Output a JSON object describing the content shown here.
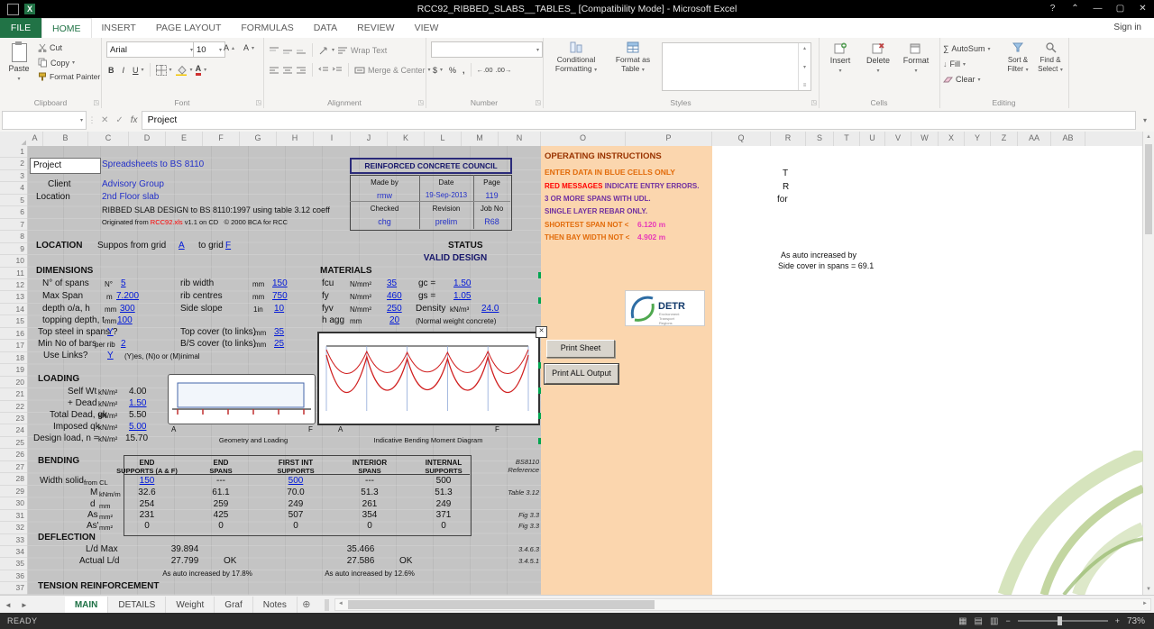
{
  "title_bar": {
    "title": "RCC92_RIBBED_SLABS__TABLES_  [Compatibility Mode] - Microsoft Excel",
    "help": "?",
    "minimize": "—",
    "maximize": "▢",
    "close": "✕"
  },
  "ribbon": {
    "file_tab": "FILE",
    "tabs": [
      "HOME",
      "INSERT",
      "PAGE LAYOUT",
      "FORMULAS",
      "DATA",
      "REVIEW",
      "VIEW"
    ],
    "sign_in": "Sign in",
    "clipboard": {
      "label": "Clipboard",
      "paste": "Paste",
      "cut": "Cut",
      "copy": "Copy",
      "painter": "Format Painter"
    },
    "font": {
      "label": "Font",
      "family": "Arial",
      "size": "10",
      "bold": "B",
      "italic": "I",
      "underline": "U"
    },
    "alignment": {
      "label": "Alignment",
      "wrap": "Wrap Text",
      "merge": "Merge & Center"
    },
    "number": {
      "label": "Number",
      "currency": "$",
      "percent": "%",
      "comma": ","
    },
    "styles": {
      "label": "Styles",
      "conditional": "Conditional Formatting",
      "format_table": "Format as Table"
    },
    "cells": {
      "label": "Cells",
      "insert": "Insert",
      "delete": "Delete",
      "format": "Format"
    },
    "editing": {
      "label": "Editing",
      "autosum": "AutoSum",
      "fill": "Fill",
      "clear": "Clear",
      "sort": "Sort & Filter",
      "find": "Find & Select"
    }
  },
  "formula_bar": {
    "name_box": "",
    "fx": "fx",
    "value": "Project"
  },
  "grid": {
    "columns": [
      "A",
      "B",
      "C",
      "D",
      "E",
      "F",
      "G",
      "H",
      "I",
      "J",
      "K",
      "L",
      "M",
      "N",
      "O",
      "P",
      "Q",
      "R",
      "S",
      "T",
      "U",
      "V",
      "W",
      "X",
      "Y",
      "Z",
      "AA",
      "AB"
    ],
    "row_count": 37
  },
  "header": {
    "project_label": "Project",
    "project_value": "Spreadsheets to BS 8110",
    "council": "REINFORCED CONCRETE COUNCIL",
    "client_label": "Client",
    "client_value": "Advisory Group",
    "location_label": "Location",
    "location_value": "2nd Floor slab",
    "design_title": "RIBBED SLAB DESIGN to BS 8110:1997 using table 3.12 coeff",
    "originated_pre": "Originated from ",
    "originated_file": "RCC92.xls",
    "originated_mid": " v1.1 on CD",
    "originated_copy": "© 2000 BCA for RCC",
    "made_by_label": "Made by",
    "made_by": "rmw",
    "date_label": "Date",
    "date": "19-Sep-2013",
    "page_label": "Page",
    "page": "119",
    "checked_label": "Checked",
    "checked": "chg",
    "revision_label": "Revision",
    "revision": "prelim",
    "job_label": "Job No",
    "job": "R68"
  },
  "location": {
    "title": "LOCATION",
    "prefix": "Suppos from grid",
    "from": "A",
    "to_label": "to grid",
    "to": "F",
    "status_label": "STATUS",
    "status_value": "VALID DESIGN"
  },
  "dimensions": {
    "title": "DIMENSIONS",
    "spans_label": "N° of spans",
    "spans_unit": "N°",
    "spans": "5",
    "max_span_label": "Max Span",
    "max_span_unit": "m",
    "max_span": "7.200",
    "depth_label": "depth o/a, h",
    "depth_unit": "mm",
    "depth": "300",
    "topping_label": "topping depth, t",
    "topping_unit": "mm",
    "topping": "100",
    "top_steel_label": "Top steel in spans ?",
    "top_steel": "Y",
    "min_bars_label": "Min No of bars",
    "min_bars_unit": "per rib",
    "min_bars": "2",
    "links_label": "Use Links?",
    "links": "Y",
    "links_note": "(Y)es, (N)o or (M)inimal",
    "rib_width_label": "rib width",
    "rib_width_unit": "mm",
    "rib_width": "150",
    "rib_centres_label": "rib centres",
    "rib_centres_unit": "mm",
    "rib_centres": "750",
    "side_slope_label": "Side slope",
    "side_slope_unit": "1in",
    "side_slope": "10",
    "top_cover_label": "Top cover (to links)",
    "top_cover_unit": "mm",
    "top_cover": "35",
    "bs_cover_label": "B/S cover (to links)",
    "bs_cover_unit": "mm",
    "bs_cover": "25"
  },
  "materials": {
    "title": "MATERIALS",
    "fcu_label": "fcu",
    "fcu_unit": "N/mm²",
    "fcu": "35",
    "fy_label": "fy",
    "fy_unit": "N/mm²",
    "fy": "460",
    "fyv_label": "fyv",
    "fyv_unit": "N/mm²",
    "fyv": "250",
    "hagg_label": "h agg",
    "hagg_unit": "mm",
    "hagg": "20",
    "gc_label": "gc =",
    "gc": "1.50",
    "gs_label": "gs =",
    "gs": "1.05",
    "density_label": "Density",
    "density_unit": "kN/m³",
    "density": "24.0",
    "normal_note": "(Normal weight concrete)"
  },
  "loading": {
    "title": "LOADING",
    "rows": [
      {
        "label": "Self Wt",
        "unit": "kN/m²",
        "value": "4.00"
      },
      {
        "label": "+ Dead",
        "unit": "kN/m²",
        "value": "1.50"
      },
      {
        "label": "Total Dead, gk",
        "unit": "kN/m²",
        "value": "5.50"
      },
      {
        "label": "Imposed qk",
        "unit": "kN/m²",
        "value": "5.00"
      },
      {
        "label": "Design load, n =",
        "unit": "kN/m²",
        "value": "15.70"
      }
    ]
  },
  "charts": {
    "geometry_caption": "Geometry and Loading",
    "moment_caption": "Indicative Bending Moment Diagram",
    "a1": "A",
    "f1": "F",
    "a2": "A",
    "f2": "F",
    "close": "✕"
  },
  "bending": {
    "title": "BENDING",
    "headers1": [
      "END",
      "END",
      "FIRST INT",
      "INTERIOR",
      "INTERNAL"
    ],
    "headers2": [
      "SUPPORTS  (A & F)",
      "SPANS",
      "SUPPORTS",
      "SPANS",
      "SUPPORTS"
    ],
    "ref1": "BS8110",
    "ref2": "Reference",
    "rows": [
      {
        "label": "Width solid",
        "unit": "from CL",
        "values": [
          "150",
          "---",
          "500",
          "---",
          "500"
        ],
        "blue": [
          true,
          false,
          true,
          false,
          false
        ],
        "ref": ""
      },
      {
        "label": "M",
        "unit": "kNm/m",
        "values": [
          "32.6",
          "61.1",
          "70.0",
          "51.3",
          "51.3"
        ],
        "ref": "Table 3.12"
      },
      {
        "label": "d",
        "unit": "mm",
        "values": [
          "254",
          "259",
          "249",
          "261",
          "249"
        ],
        "ref": ""
      },
      {
        "label": "As",
        "unit": "mm²",
        "values": [
          "231",
          "425",
          "507",
          "354",
          "371"
        ],
        "ref": "Fig 3.3"
      },
      {
        "label": "As'",
        "unit": "mm²",
        "values": [
          "0",
          "0",
          "0",
          "0",
          "0"
        ],
        "ref": "Fig 3.3"
      }
    ]
  },
  "deflection": {
    "title": "DEFLECTION",
    "ld_label": "L/d Max",
    "ld_1": "39.894",
    "ld_2": "35.466",
    "ld_ref": "3.4.6.3",
    "act_label": "Actual L/d",
    "act_1": "27.799",
    "ok_1": "OK",
    "act_2": "27.586",
    "ok_2": "OK",
    "act_ref": "3.4.5.1",
    "auto_1": "As auto increased by 17.8%",
    "auto_2": "As auto increased by 12.6%"
  },
  "tension": {
    "title": "TENSION REINFORCEMENT"
  },
  "instructions": {
    "title": "OPERATING INSTRUCTIONS",
    "line1": "ENTER DATA IN BLUE CELLS ONLY",
    "line2a": "RED MESSAGES",
    "line2b": " INDICATE ENTRY ERRORS.",
    "line3": "3 OR MORE SPANS WITH UDL.",
    "line4": "SINGLE LAYER REBAR ONLY.",
    "line5_label": "SHORTEST SPAN NOT <",
    "line5_value": "6.120 m",
    "line6_label": "THEN BAY WIDTH NOT <",
    "line6_value": "4.902 m",
    "logo": "DETR",
    "logo_sub1": "Environment",
    "logo_sub2": "Transport",
    "logo_sub3": "Regions",
    "print_sheet": "Print Sheet",
    "print_all": "Print ALL Output"
  },
  "side_notes": {
    "t": "T",
    "r": "R",
    "for_label": "for",
    "auto_note": "As auto increased by",
    "cover_note": "Side cover in spans =  69.1"
  },
  "sheet_tabs": {
    "tabs": [
      "MAIN",
      "DETAILS",
      "Weight",
      "Graf",
      "Notes"
    ],
    "active": "MAIN",
    "add": "⊕"
  },
  "status_bar": {
    "ready": "READY",
    "zoom": "73%",
    "zoom_minus": "−",
    "zoom_plus": "+"
  }
}
